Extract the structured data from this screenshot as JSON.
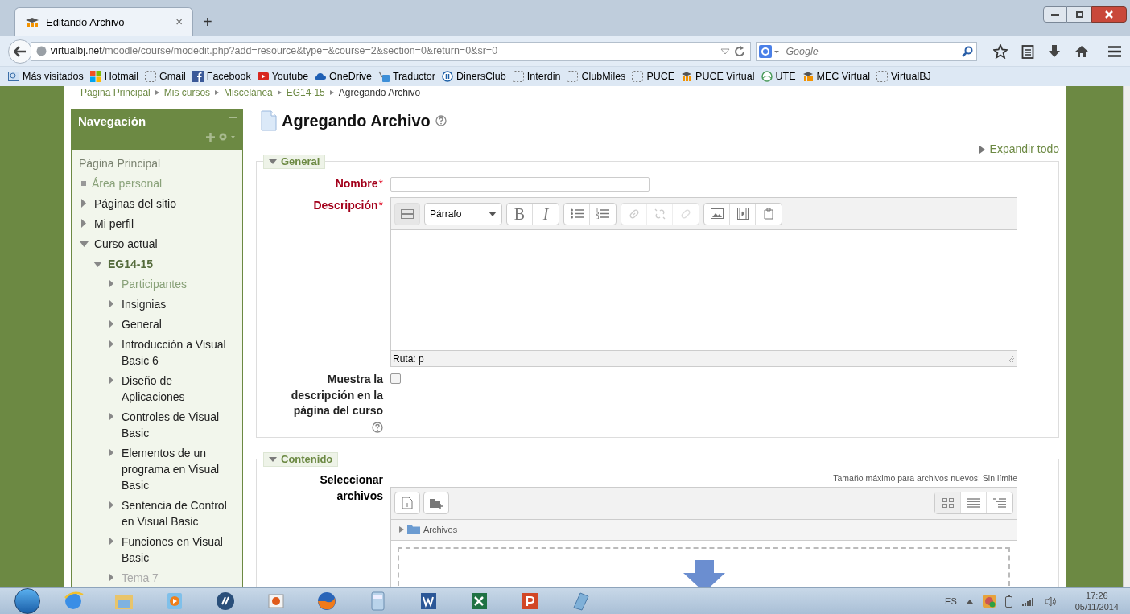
{
  "browser": {
    "tab_title": "Editando Archivo",
    "tab_close": "×",
    "new_tab": "+",
    "url_host": "virtualbj.net",
    "url_path": "/moodle/course/modedit.php?add=resource&type=&course=2&section=0&return=0&sr=0",
    "search_placeholder": "Google"
  },
  "bookmarks": [
    {
      "label": "Más visitados"
    },
    {
      "label": "Hotmail"
    },
    {
      "label": "Gmail"
    },
    {
      "label": "Facebook"
    },
    {
      "label": "Youtube"
    },
    {
      "label": "OneDrive"
    },
    {
      "label": "Traductor"
    },
    {
      "label": "DinersClub"
    },
    {
      "label": "Interdin"
    },
    {
      "label": "ClubMiles"
    },
    {
      "label": "PUCE"
    },
    {
      "label": "PUCE Virtual"
    },
    {
      "label": "UTE"
    },
    {
      "label": "MEC Virtual"
    },
    {
      "label": "VirtualBJ"
    }
  ],
  "breadcrumb": [
    "Página Principal",
    "Mis cursos",
    "Miscelánea",
    "EG14-15",
    "Agregando Archivo"
  ],
  "navigation": {
    "title": "Navegación",
    "items": [
      {
        "label": "Página Principal",
        "kind": "home",
        "children": [
          {
            "label": "Área personal",
            "kind": "leaf"
          },
          {
            "label": "Páginas del sitio",
            "kind": "branch",
            "expanded": false
          },
          {
            "label": "Mi perfil",
            "kind": "branch",
            "expanded": false
          },
          {
            "label": "Curso actual",
            "kind": "branch",
            "expanded": true,
            "children": [
              {
                "label": "EG14-15",
                "kind": "course",
                "expanded": true,
                "children": [
                  {
                    "label": "Participantes",
                    "kind": "active",
                    "expanded": false
                  },
                  {
                    "label": "Insignias",
                    "kind": "branch",
                    "expanded": false
                  },
                  {
                    "label": "General",
                    "kind": "branch",
                    "expanded": false
                  },
                  {
                    "label": "Introducción a Visual Basic 6",
                    "kind": "branch",
                    "expanded": false
                  },
                  {
                    "label": "Diseño de Aplicaciones",
                    "kind": "branch",
                    "expanded": false
                  },
                  {
                    "label": "Controles de Visual Basic",
                    "kind": "branch",
                    "expanded": false
                  },
                  {
                    "label": "Elementos de un programa en Visual Basic",
                    "kind": "branch",
                    "expanded": false
                  },
                  {
                    "label": "Sentencia de Control en Visual Basic",
                    "kind": "branch",
                    "expanded": false
                  },
                  {
                    "label": "Funciones en Visual Basic",
                    "kind": "branch",
                    "expanded": false
                  },
                  {
                    "label": "Tema 7",
                    "kind": "dimmed",
                    "expanded": false
                  }
                ]
              }
            ]
          }
        ]
      }
    ]
  },
  "page": {
    "heading": "Agregando Archivo",
    "expand_all": "Expandir todo"
  },
  "general": {
    "legend": "General",
    "expanded": true,
    "name_label": "Nombre",
    "description_label": "Descripción",
    "required_mark": "*",
    "editor": {
      "format": "Párrafo",
      "bold": "B",
      "italic": "I",
      "path": "Ruta: p"
    },
    "show_description": {
      "label": "Muestra la descripción en la página del curso",
      "checked": false
    }
  },
  "content": {
    "legend": "Contenido",
    "expanded": true,
    "files_label": "Seleccionar archivos",
    "max_size": "Tamaño máximo para archivos nuevos: Sin límite",
    "folder": "Archivos"
  },
  "taskbar": {
    "language": "ES",
    "time": "17:26",
    "date": "05/11/2014"
  }
}
